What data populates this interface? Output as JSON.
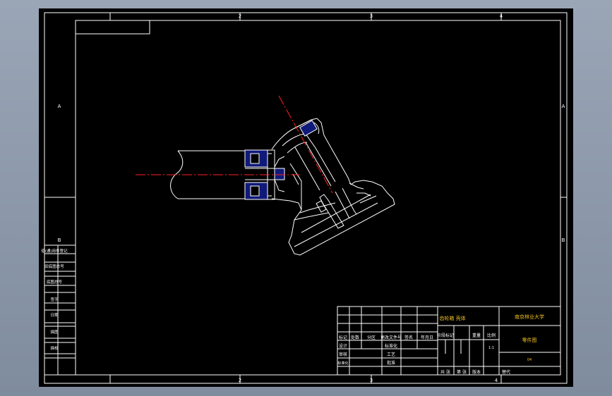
{
  "border": {
    "top_zones": [
      "2",
      "3",
      "4"
    ],
    "bottom_zones": [
      "2",
      "3",
      "4"
    ],
    "left_zones": [
      "A",
      "B"
    ],
    "right_zones": [
      "A",
      "B"
    ]
  },
  "left_strip": [
    "借(通)用件登记",
    "旧底图总号",
    "底图总号",
    "签字",
    "日期",
    "描图",
    "描校"
  ],
  "title_block": {
    "row_headers": [
      "标记",
      "处数",
      "分区",
      "更改文件号",
      "签名",
      "年月日"
    ],
    "role_labels": [
      "设计",
      "审核",
      "工艺",
      "标准化",
      "批准"
    ],
    "material": "齿轮箱 壳体",
    "stage_header": "阶段标记",
    "weight_header": "重量",
    "scale_header": "比例",
    "scale_value": "1:1",
    "sheet_count": "共 张",
    "sheet_no": "第 张",
    "version": "版本",
    "replace": "替代",
    "school": "南京林业大学",
    "drawing_name": "零件图",
    "drawing_code": "04"
  },
  "colors": {
    "line": "#ffffff",
    "centerline": "#ff2020",
    "section_fill": "#101a7a",
    "title_text": "#f0c020",
    "background": "#000000"
  }
}
